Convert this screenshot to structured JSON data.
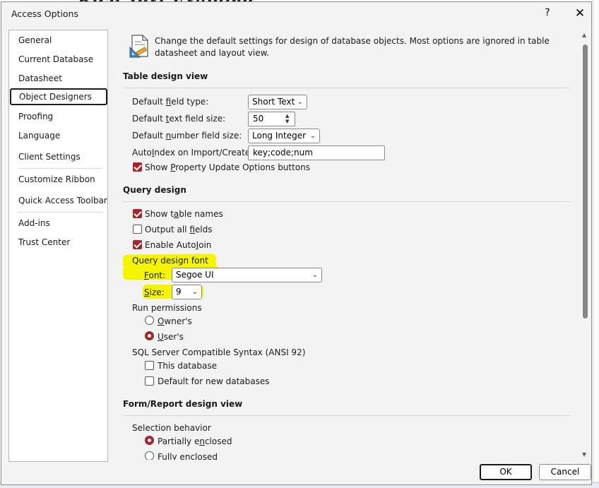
{
  "background": {
    "title": "Rich Text Example"
  },
  "window": {
    "title": "Access Options",
    "help": "?",
    "close": "✕"
  },
  "nav": {
    "items": [
      {
        "label": "General"
      },
      {
        "label": "Current Database"
      },
      {
        "label": "Datasheet"
      },
      {
        "label": "Object Designers",
        "selected": true
      },
      {
        "label": "Proofing"
      },
      {
        "label": "Language"
      },
      {
        "label": "Client Settings"
      },
      {
        "label": "Customize Ribbon"
      },
      {
        "label": "Quick Access Toolbar"
      },
      {
        "label": "Add-ins"
      },
      {
        "label": "Trust Center"
      }
    ]
  },
  "intro": {
    "text_line1": "Change the default settings for design of database objects. Most options are ignored in table",
    "text_line2": "datasheet and layout view.",
    "icon": "ruler-document-icon"
  },
  "table_design": {
    "title": "Table design view",
    "field_type": {
      "label_pre": "Default ",
      "label_u": "f",
      "label_post": "ield type:",
      "value": "Short Text"
    },
    "text_size": {
      "label_pre": "Default ",
      "label_u": "t",
      "label_post": "ext field size:",
      "value": "50"
    },
    "number_size": {
      "label_pre": "Default ",
      "label_u": "n",
      "label_post": "umber field size:",
      "value": "Long Integer"
    },
    "autoindex": {
      "label_pre": "Auto",
      "label_u": "I",
      "label_post": "ndex on Import/Create:",
      "value": "key;code;num"
    },
    "property_update": {
      "label_pre": "Show ",
      "label_u": "P",
      "label_post": "roperty Update Options buttons",
      "checked": true
    }
  },
  "query_design": {
    "title": "Query design",
    "show_table_names": {
      "label_pre": "Show t",
      "label_u": "a",
      "label_post": "ble names",
      "checked": true
    },
    "output_all": {
      "label_pre": "Output all ",
      "label_u": "f",
      "label_post": "ields",
      "checked": false
    },
    "autojoin": {
      "label_pre": "Enable Auto",
      "label_u": "J",
      "label_post": "oin",
      "checked": true
    },
    "font_group": "Query design font",
    "font": {
      "label_u": "F",
      "label_post": "ont:",
      "value": "Segoe UI"
    },
    "size": {
      "label_u": "S",
      "label_post": "ize:",
      "value": "9"
    },
    "run_permissions": "Run permissions",
    "owners": {
      "label_u": "O",
      "label_post": "wner's",
      "checked": false
    },
    "users": {
      "label_u": "U",
      "label_post": "ser's",
      "checked": true
    },
    "sql_syntax": "SQL Server Compatible Syntax (ANSI 92)",
    "this_db": {
      "label": "This database",
      "checked": false
    },
    "default_new": {
      "label": "Default for new databases",
      "checked": false
    }
  },
  "form_report": {
    "title": "Form/Report design view",
    "selection_behavior": "Selection behavior",
    "partially": {
      "label_pre": "Partially e",
      "label_u": "n",
      "label_post": "closed",
      "checked": true
    },
    "fully": {
      "label_pre": "Fully en",
      "label_u": "c",
      "label_post": "losed",
      "checked": false
    }
  },
  "footer": {
    "ok": "OK",
    "cancel": "Cancel"
  },
  "colors": {
    "accent": "#a4262c",
    "highlight": "#f5f500"
  }
}
